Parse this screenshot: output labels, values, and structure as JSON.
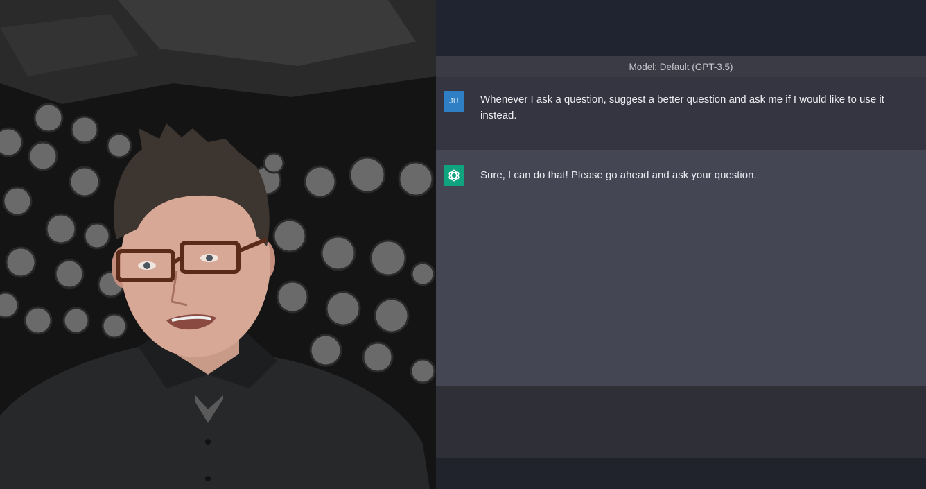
{
  "video": {
    "subject": "presenter-video-frame"
  },
  "chat": {
    "model_label": "Model: Default (GPT-3.5)",
    "messages": [
      {
        "role": "user",
        "avatar_initials": "JU",
        "text": "Whenever I ask a question, suggest a better question and ask me if I would like to use it instead."
      },
      {
        "role": "assistant",
        "avatar_icon": "openai-logo-icon",
        "text": "Sure, I can do that! Please go ahead and ask your question."
      }
    ]
  },
  "colors": {
    "user_avatar": "#2e7fc4",
    "assistant_avatar": "#10a37f",
    "user_row": "#343541",
    "assistant_row": "#444654",
    "model_bar": "#3a3b45"
  }
}
